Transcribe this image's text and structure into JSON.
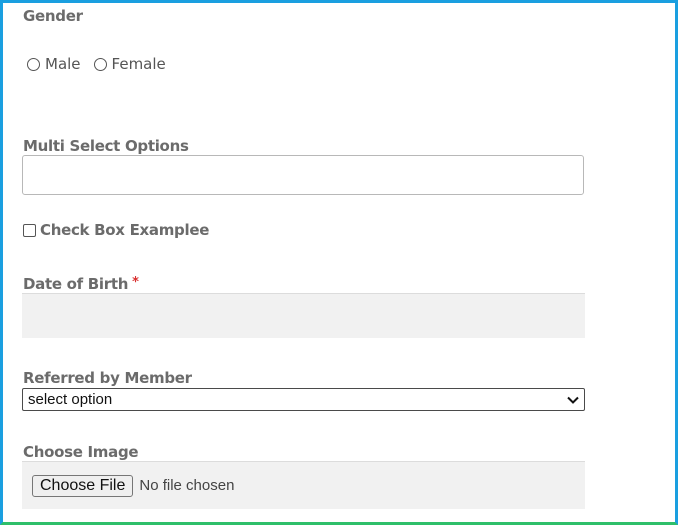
{
  "form": {
    "gender": {
      "label": "Gender",
      "options": [
        {
          "label": "Male",
          "selected": false
        },
        {
          "label": "Female",
          "selected": false
        }
      ]
    },
    "multi_select": {
      "label": "Multi Select Options",
      "value": ""
    },
    "checkbox": {
      "label": "Check Box Examplee",
      "checked": false
    },
    "dob": {
      "label": "Date of Birth",
      "required_marker": "*",
      "value": ""
    },
    "referred_by": {
      "label": "Referred by Member",
      "selected": "select option"
    },
    "image": {
      "label": "Choose Image",
      "button_label": "Choose File",
      "status": "No file chosen"
    }
  },
  "colors": {
    "frame_top": "#1a9fe0",
    "frame_bottom": "#2fbf6a",
    "label_text": "#6b6b6b",
    "required": "#d93030",
    "field_bg": "#f1f1f1"
  },
  "icons": {
    "select_arrow": "chevron-down-icon"
  }
}
